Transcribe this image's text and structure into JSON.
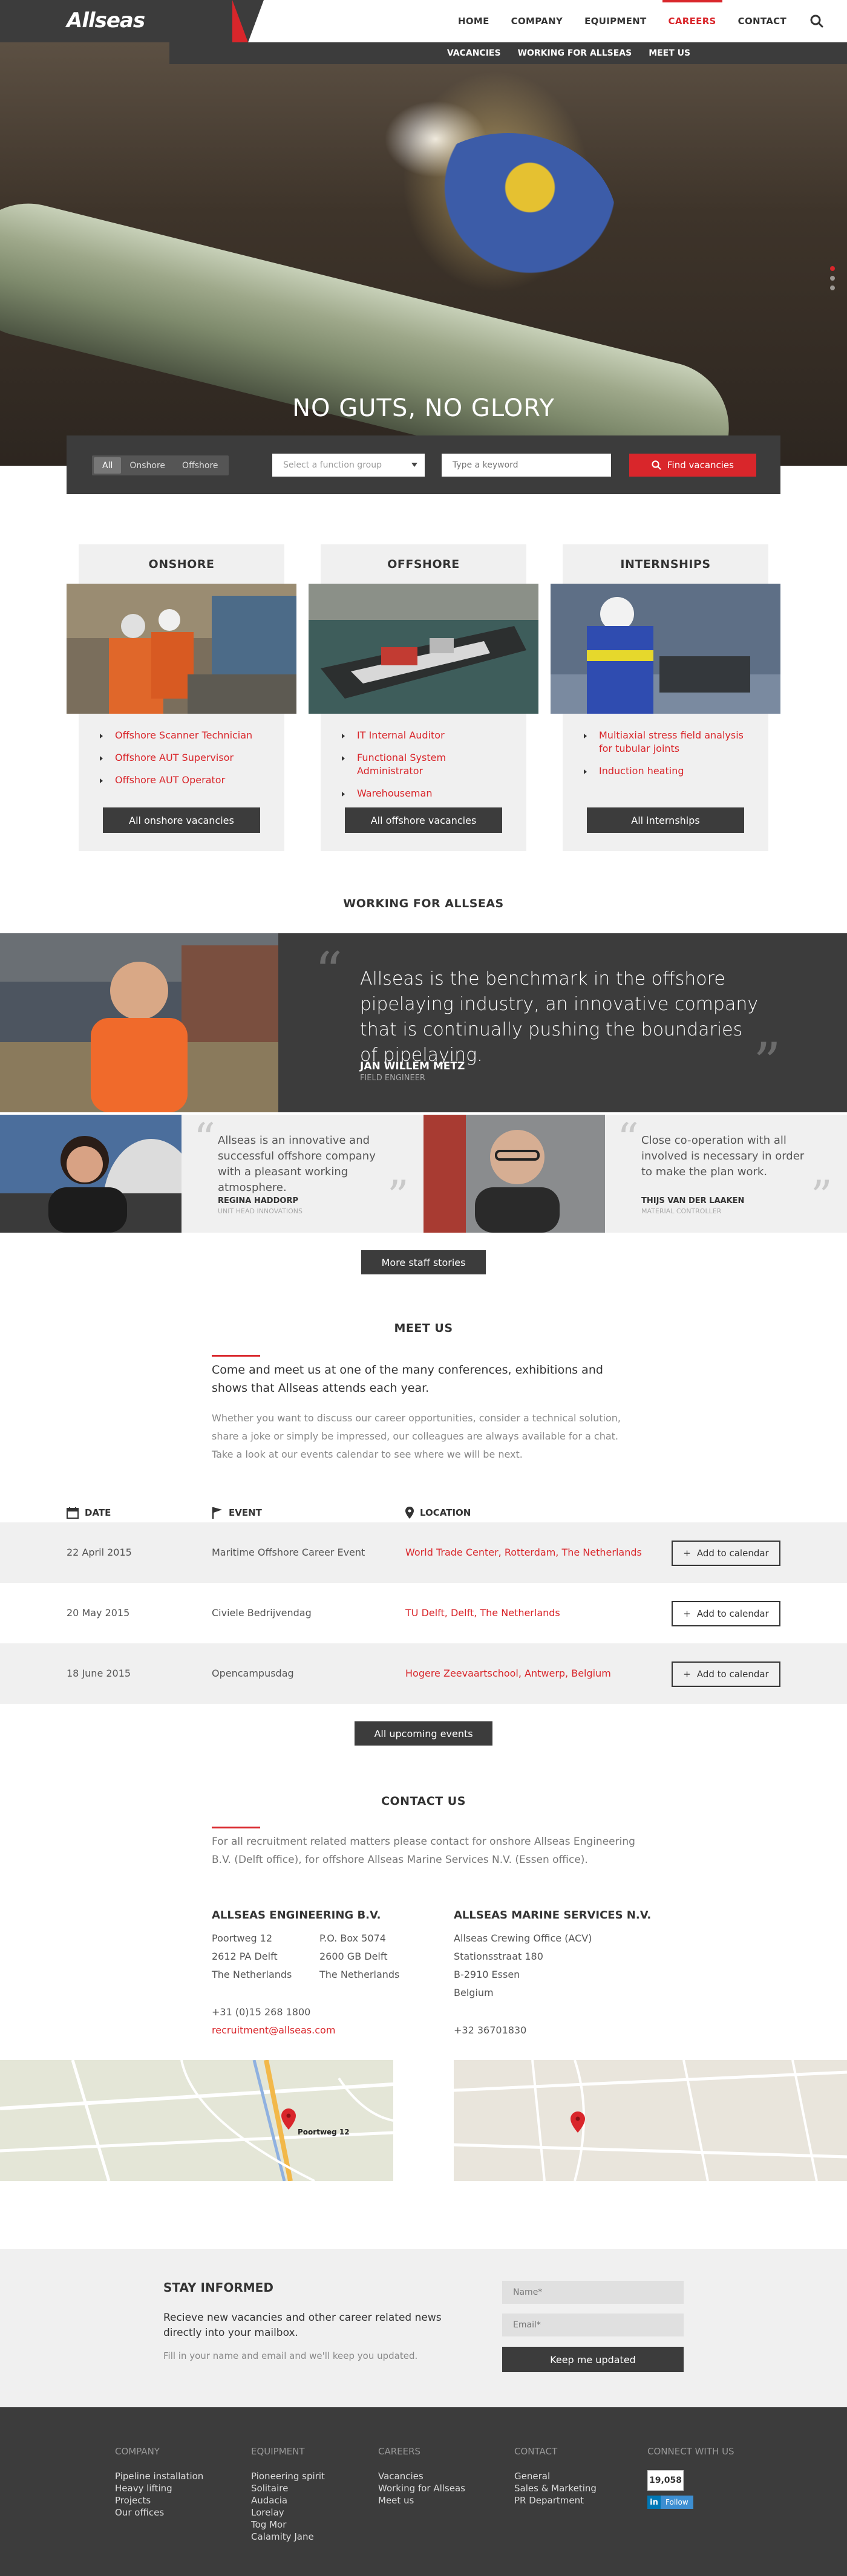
{
  "header": {
    "logo": "Allseas",
    "nav": [
      "HOME",
      "COMPANY",
      "EQUIPMENT",
      "CAREERS",
      "CONTACT"
    ],
    "active": "CAREERS",
    "subnav": [
      "VACANCIES",
      "WORKING FOR ALLSEAS",
      "MEET US"
    ]
  },
  "hero": {
    "title": "NO GUTS, NO GLORY"
  },
  "search": {
    "segments": [
      "All",
      "Onshore",
      "Offshore"
    ],
    "selected_segment": "All",
    "function_group_placeholder": "Select a function group",
    "keyword_placeholder": "Type a keyword",
    "find_label": "Find vacancies"
  },
  "vacancies": [
    {
      "title": "ONSHORE",
      "items": [
        "Offshore Scanner Technician",
        "Offshore AUT Supervisor",
        "Offshore AUT Operator"
      ],
      "button": "All onshore vacancies"
    },
    {
      "title": "OFFSHORE",
      "items": [
        "IT Internal Auditor",
        "Functional System Administrator",
        "Warehouseman"
      ],
      "button": "All offshore vacancies"
    },
    {
      "title": "INTERNSHIPS",
      "items": [
        "Multiaxial stress field analysis for tubular joints",
        "Induction heating"
      ],
      "button": "All internships"
    }
  ],
  "working": {
    "title": "WORKING FOR ALLSEAS",
    "main": {
      "quote": "Allseas is the benchmark in the offshore pipelaying industry, an innovative company that is continually pushing the boundaries of pipelaying.",
      "name": "JAN WILLEM METZ",
      "role": "FIELD ENGINEER"
    },
    "small": [
      {
        "quote": "Allseas is an innovative and successful offshore company with a pleasant working atmosphere.",
        "name": "REGINA HADDORP",
        "role": "UNIT HEAD INNOVATIONS"
      },
      {
        "quote": "Close co-operation with all involved is necessary in order to make the plan work.",
        "name": "THIJS VAN DER LAAKEN",
        "role": "MATERIAL CONTROLLER"
      }
    ],
    "more_label": "More staff stories"
  },
  "meet": {
    "title": "MEET US",
    "lead": "Come and meet us at one of the many conferences, exhibitions and shows that Allseas attends each year.",
    "body": "Whether you want to discuss our career opportunities, consider a technical solution, share a joke or simply be impressed, our colleagues are always available for a chat. Take a look at our events calendar to see where we will be next.",
    "headers": {
      "date": "DATE",
      "event": "EVENT",
      "location": "LOCATION"
    },
    "events": [
      {
        "date": "22 April 2015",
        "event": "Maritime Offshore Career Event",
        "location": "World Trade Center, Rotterdam, The Netherlands"
      },
      {
        "date": "20 May 2015",
        "event": "Civiele Bedrijvendag",
        "location": "TU Delft, Delft, The Netherlands"
      },
      {
        "date": "18 June 2015",
        "event": "Opencampusdag",
        "location": "Hogere Zeevaartschool, Antwerp, Belgium"
      }
    ],
    "add_label": "Add to calendar",
    "all_label": "All upcoming events"
  },
  "contact": {
    "title": "CONTACT US",
    "lead": "For all recruitment related matters please contact for onshore Allseas Engineering B.V. (Delft office), for offshore Allseas Marine Services N.V. (Essen office).",
    "engineering": {
      "name": "ALLSEAS ENGINEERING B.V.",
      "address": [
        "Poortweg 12",
        "2612 PA Delft",
        "The Netherlands"
      ],
      "postal": [
        "P.O. Box 5074",
        "2600 GB Delft",
        "The Netherlands"
      ],
      "phone": "+31 (0)15 268 1800",
      "email": "recruitment@allseas.com"
    },
    "marine": {
      "name": "ALLSEAS MARINE SERVICES N.V.",
      "address": [
        "Allseas Crewing Office (ACV)",
        "Stationsstraat 180",
        "B-2910 Essen",
        "Belgium"
      ],
      "phone": "+32 36701830"
    },
    "map_label": "Poortweg 12"
  },
  "newsletter": {
    "title": "STAY INFORMED",
    "text": "Recieve new vacancies and other career related news directly into your mailbox.",
    "note": "Fill in your name and email and we'll keep you updated.",
    "name_placeholder": "Name*",
    "email_placeholder": "Email*",
    "button": "Keep me updated"
  },
  "footer": {
    "columns": [
      {
        "title": "COMPANY",
        "links": [
          "Pipeline installation",
          "Heavy lifting",
          "Projects",
          "Our offices"
        ]
      },
      {
        "title": "EQUIPMENT",
        "links": [
          "Pioneering spirit",
          "Solitaire",
          "Audacia",
          "Lorelay",
          "Tog Mor",
          "Calamity Jane"
        ]
      },
      {
        "title": "CAREERS",
        "links": [
          "Vacancies",
          "Working for Allseas",
          "Meet us"
        ]
      },
      {
        "title": "CONTACT",
        "links": [
          "General",
          "Sales & Marketing",
          "PR Department"
        ]
      }
    ],
    "connect": {
      "title": "CONNECT WITH US",
      "count": "19,058",
      "follow": "Follow"
    }
  },
  "colors": {
    "accent": "#d9262b",
    "dark": "#3c3c3c",
    "light": "#f0f0f0"
  }
}
